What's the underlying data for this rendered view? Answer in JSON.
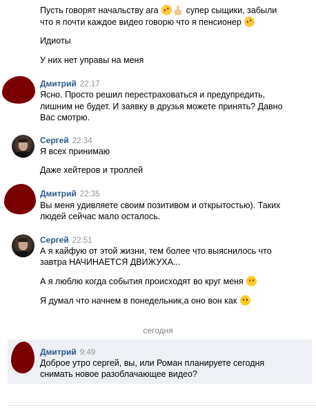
{
  "messages": {
    "m0": {
      "lines": [
        "Пусть говорят начальству ага",
        "супер сыщики, забыли",
        "что я почти каждое видео говорю что я пенсионер",
        "Идиоты",
        "У них нет управы на меня"
      ]
    },
    "m1": {
      "author": "Дмитрий",
      "time": "22:17",
      "lines": [
        "Ясно. Просто решил перестраховаться и предупредить,",
        "лишним не будет. И заявку в друзья можете принять? Давно",
        "Вас смотрю."
      ]
    },
    "m2": {
      "author": "Сергей",
      "time": "22:34",
      "lines": [
        "Я всех принимаю",
        "Даже хейтеров и троллей"
      ]
    },
    "m3": {
      "author": "Дмитрий",
      "time": "22:35",
      "lines": [
        "Вы меня удивляете своим позитивом и открытостью). Таких",
        "людей сейчас мало осталось."
      ]
    },
    "m4": {
      "author": "Сергей",
      "time": "22:51",
      "lines": [
        "А я кайфую от этой жизни, тем более что выяснилось что",
        "завтра НАЧИНАЕТСЯ ДВИЖУХА...",
        "А я люблю когда события происходят во круг меня",
        "Я думал что начнем в понедельник,а оно вон как"
      ]
    },
    "separator": "сегодня",
    "m5": {
      "author": "Дмитрий",
      "time": "9:49",
      "lines": [
        "Доброе утро сергей, вы, или Роман планируете сегодня",
        "снимать новое разоблачающее видео?"
      ]
    }
  },
  "emoji": {
    "laughing": "rolling-on-floor-laughing-emoji",
    "thumbs_up": "thumbs-up-emoji",
    "smile": "smiling-face-emoji"
  }
}
